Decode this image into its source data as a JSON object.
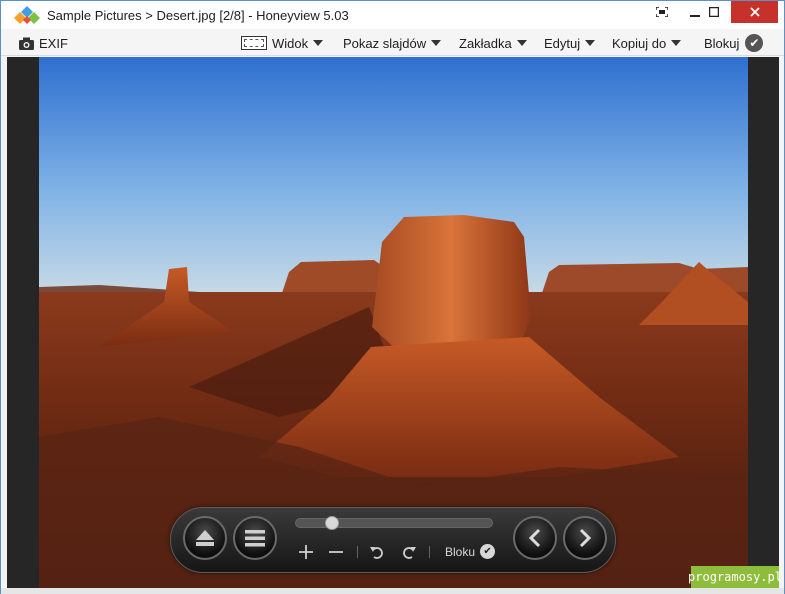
{
  "window": {
    "title": "Sample Pictures > Desert.jpg [2/8] - Honeyview 5.03",
    "controls": {
      "fullscreen_icon": "fullscreen-icon",
      "minimize_icon": "minimize-icon",
      "maximize_icon": "maximize-icon",
      "close_icon": "close-icon"
    }
  },
  "toolbar": {
    "exif_label": "EXIF",
    "view_label": "Widok",
    "slideshow_label": "Pokaz slajdów",
    "bookmark_label": "Zakładka",
    "edit_label": "Edytuj",
    "copy_label": "Kopiuj do",
    "lock_label": "Blokuj"
  },
  "controlbar": {
    "seek_position": 0.16,
    "lock_label": "Bloku",
    "icons": [
      "eject-icon",
      "menu-icon",
      "zoom-in-icon",
      "zoom-out-icon",
      "rotate-left-icon",
      "rotate-right-icon",
      "check-icon",
      "previous-icon",
      "next-icon"
    ]
  },
  "watermark": {
    "text": "programosy.pl"
  },
  "colors": {
    "close_button": "#c7312b",
    "title_bg": "#ffffff",
    "viewer_bg": "#262626",
    "watermark_bg": "#8ebd3c"
  }
}
